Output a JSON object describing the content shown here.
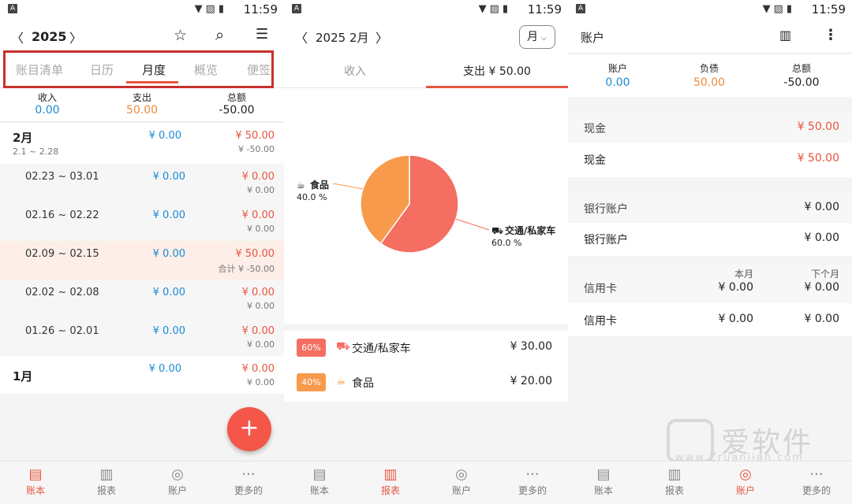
{
  "status": {
    "time": "11:59",
    "badge": "A"
  },
  "p1": {
    "year": "2025",
    "tabs": [
      "账目清单",
      "日历",
      "月度",
      "概览",
      "便签"
    ],
    "summary": {
      "income_label": "收入",
      "income": "0.00",
      "expense_label": "支出",
      "expense": "50.00",
      "total_label": "总额",
      "total": "-50.00"
    },
    "month_feb": {
      "name": "2月",
      "range": "2.1 ~ 2.28",
      "income": "¥ 0.00",
      "expense": "¥ 50.00",
      "total": "¥ -50.00"
    },
    "weeks": [
      {
        "range": "02.23  ~  03.01",
        "income": "¥ 0.00",
        "expense": "¥ 0.00",
        "total": "¥ 0.00"
      },
      {
        "range": "02.16  ~  02.22",
        "income": "¥ 0.00",
        "expense": "¥ 0.00",
        "total": "¥ 0.00"
      },
      {
        "range": "02.09  ~  02.15",
        "income": "¥ 0.00",
        "expense": "¥ 50.00",
        "total": "合计 ¥ -50.00"
      },
      {
        "range": "02.02  ~  02.08",
        "income": "¥ 0.00",
        "expense": "¥ 0.00",
        "total": "¥ 0.00"
      },
      {
        "range": "01.26  ~  02.01",
        "income": "¥ 0.00",
        "expense": "¥ 0.00",
        "total": "¥ 0.00"
      }
    ],
    "month_jan": {
      "name": "1月",
      "income": "¥ 0.00",
      "expense": "¥ 0.00",
      "total": "¥ 0.00"
    },
    "fab": "+"
  },
  "p2": {
    "title": "2025 2月",
    "period_select": "月",
    "tabs": {
      "income": "收入",
      "expense": "支出  ¥ 50.00"
    },
    "chart_data": {
      "type": "pie",
      "categories": [
        "交通/私家车",
        "食品"
      ],
      "values": [
        60.0,
        40.0
      ],
      "labels": [
        {
          "name": "食品",
          "pct": "40.0 %"
        },
        {
          "name": "交通/私家车",
          "pct": "60.0 %"
        }
      ],
      "colors": [
        "#f46e62",
        "#f89a4c"
      ]
    },
    "list": [
      {
        "pct": "60%",
        "name": "交通/私家车",
        "amount": "¥ 30.00",
        "color": "#f46e62"
      },
      {
        "pct": "40%",
        "name": "食品",
        "amount": "¥ 20.00",
        "color": "#f89a4c"
      }
    ]
  },
  "p3": {
    "title": "账户",
    "summary": {
      "account_label": "账户",
      "account": "0.00",
      "debt_label": "负债",
      "debt": "50.00",
      "total_label": "总额",
      "total": "-50.00"
    },
    "cash": {
      "group": "现金",
      "group_amount": "¥ 50.00",
      "item": "现金",
      "item_amount": "¥ 50.00"
    },
    "bank": {
      "group": "银行账户",
      "group_amount": "¥ 0.00",
      "item": "银行账户",
      "item_amount": "¥ 0.00"
    },
    "credit": {
      "group": "信用卡",
      "col1": "本月",
      "col2": "下个月",
      "group_c1": "¥ 0.00",
      "group_c2": "¥ 0.00",
      "item": "信用卡",
      "item_c1": "¥ 0.00",
      "item_c2": "¥ 0.00"
    },
    "watermark": "爱软件",
    "watermark_url": "www.Zruanjian.com"
  },
  "nav": [
    "账本",
    "报表",
    "账户",
    "更多的"
  ]
}
